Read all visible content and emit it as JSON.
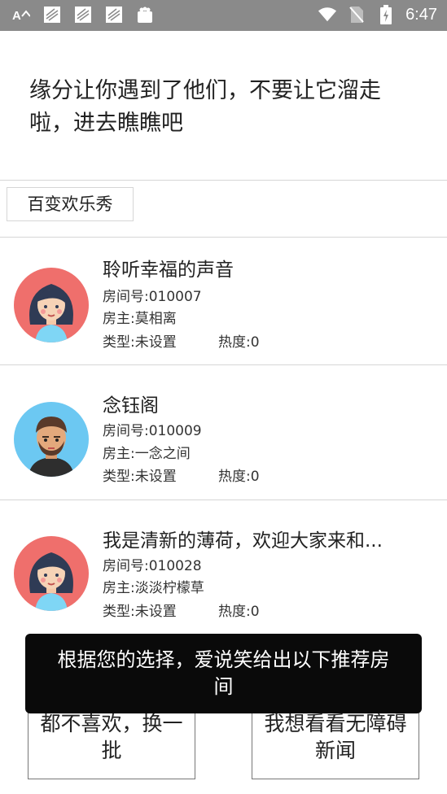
{
  "status_bar": {
    "time": "6:47",
    "icons_left": [
      "keyboard-icon",
      "notification-image-icon",
      "notification-image-icon",
      "notification-image-icon",
      "bag-icon"
    ],
    "icons_right": [
      "wifi-icon",
      "no-sim-icon",
      "battery-charging-icon"
    ]
  },
  "headline": "缘分让你遇到了他们，不要让它溜走啦，进去瞧瞧吧",
  "category_tag": "百变欢乐秀",
  "rooms": [
    {
      "title": "聆听幸福的声音",
      "room_no": "房间号:010007",
      "owner": "房主:莫相离",
      "type": "类型:未设置",
      "heat": "热度:0",
      "avatar": "female-avatar-icon"
    },
    {
      "title": "念钰阁",
      "room_no": "房间号:010009",
      "owner": "房主:一念之间",
      "type": "类型:未设置",
      "heat": "热度:0",
      "avatar": "male-avatar-icon"
    },
    {
      "title": "我是清新的薄荷，欢迎大家来和...",
      "room_no": "房间号:010028",
      "owner": "房主:淡淡柠檬草",
      "type": "类型:未设置",
      "heat": "热度:0",
      "avatar": "female-avatar-icon"
    }
  ],
  "toast": "根据您的选择，爱说笑给出以下推荐房间",
  "buttons": {
    "change": "都不喜欢，换一批",
    "accessible_news": "我想看看无障碍新闻"
  },
  "colors": {
    "status_bar": "#8a8a8a",
    "toast_bg": "#0a0a0a",
    "female_avatar_bg": "#ef6f6c",
    "male_avatar_bg": "#6cc8f2"
  }
}
